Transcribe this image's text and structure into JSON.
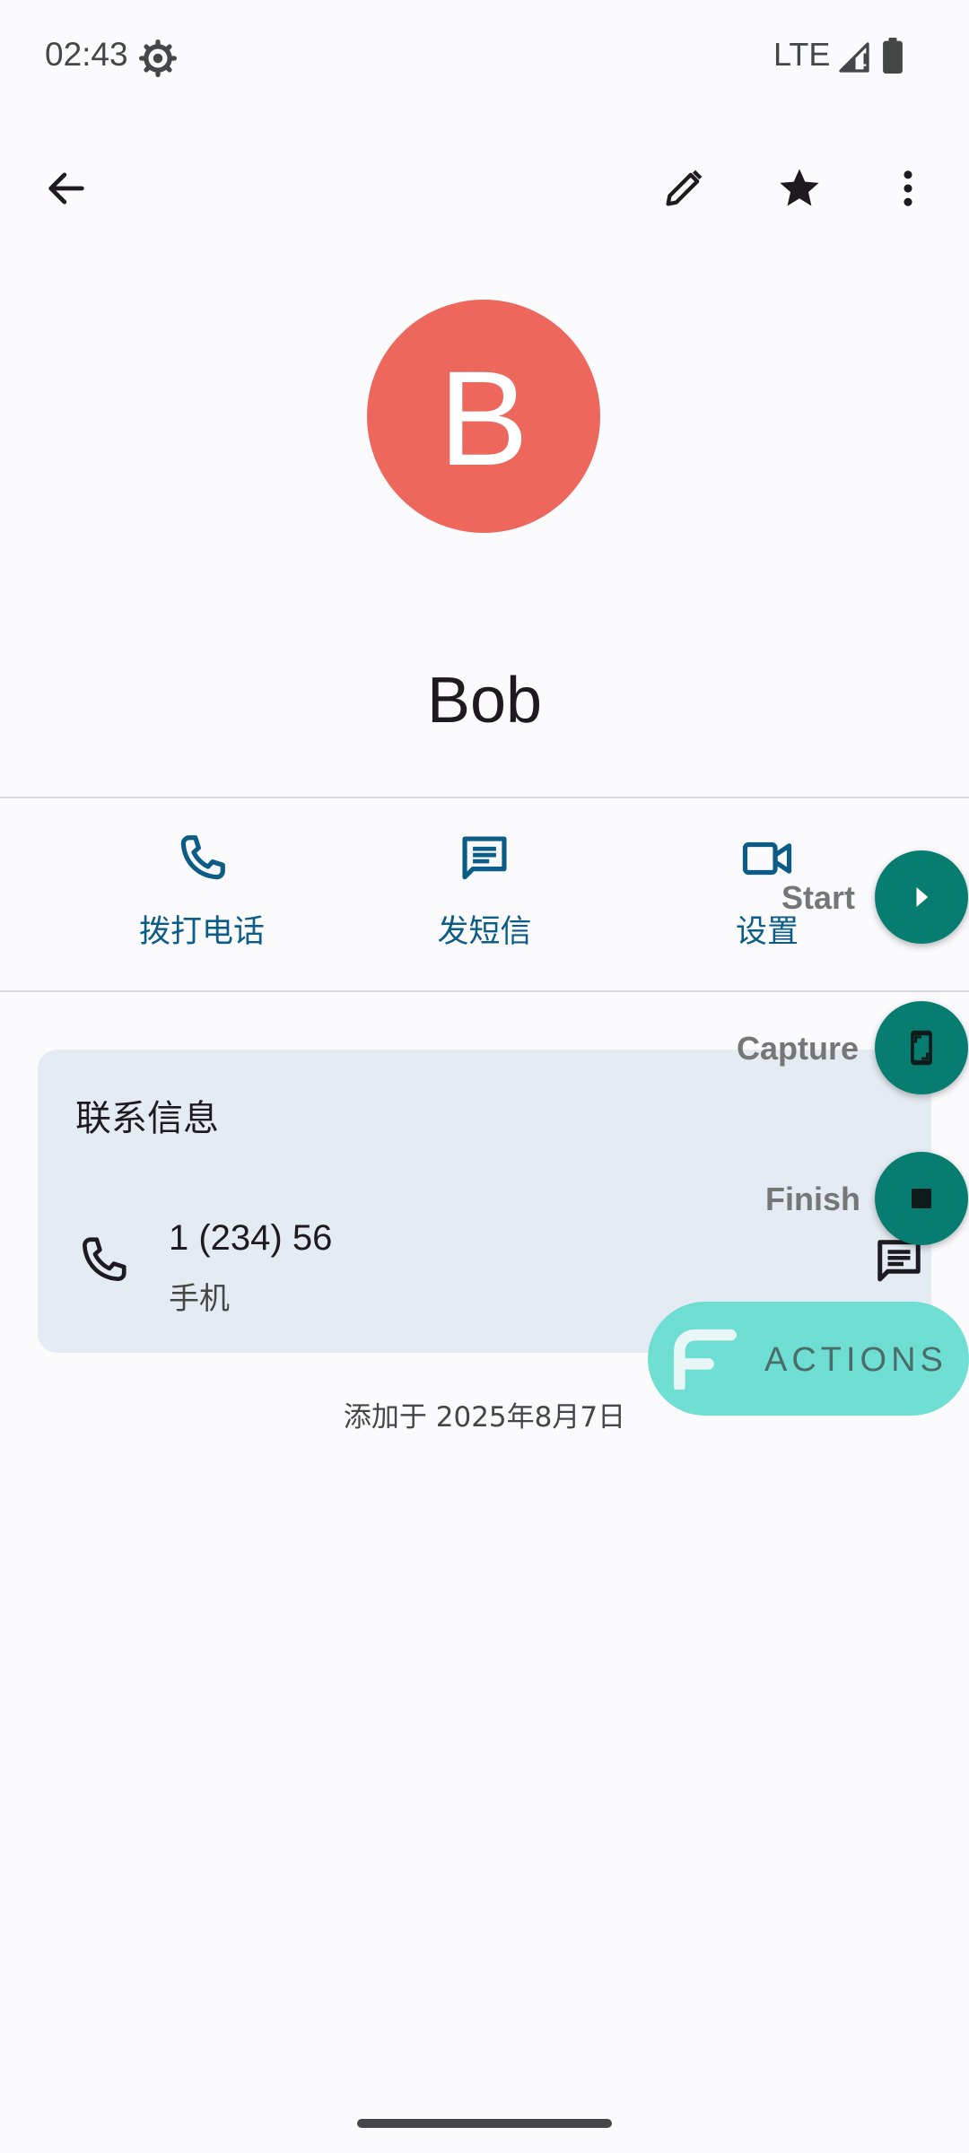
{
  "status_bar": {
    "time": "02:43",
    "network": "LTE",
    "icons": [
      "settings-gear-icon",
      "signal-icon",
      "battery-icon"
    ]
  },
  "top_bar": {
    "icons": [
      "back-arrow-icon",
      "edit-pencil-icon",
      "star-icon",
      "more-vert-icon"
    ]
  },
  "contact": {
    "avatar_letter": "B",
    "avatar_color": "#ee675c",
    "name": "Bob"
  },
  "actions": [
    {
      "label": "拨打电话",
      "icon": "phone-icon"
    },
    {
      "label": "发短信",
      "icon": "message-icon"
    },
    {
      "label": "设置",
      "icon": "video-icon"
    }
  ],
  "card": {
    "title": "联系信息",
    "phone_number": "1 (234) 56",
    "phone_type": "手机"
  },
  "added_date": "添加于 2025年8月7日",
  "overlay": {
    "start_label": "Start",
    "capture_label": "Capture",
    "finish_label": "Finish",
    "actions_label": "ACTIONS",
    "fab_color": "#067d70",
    "pill_color": "#64dccf"
  },
  "colors": {
    "accent": "#0b5d87",
    "background": "#fbfafd",
    "card_background": "#e5ebf2"
  }
}
